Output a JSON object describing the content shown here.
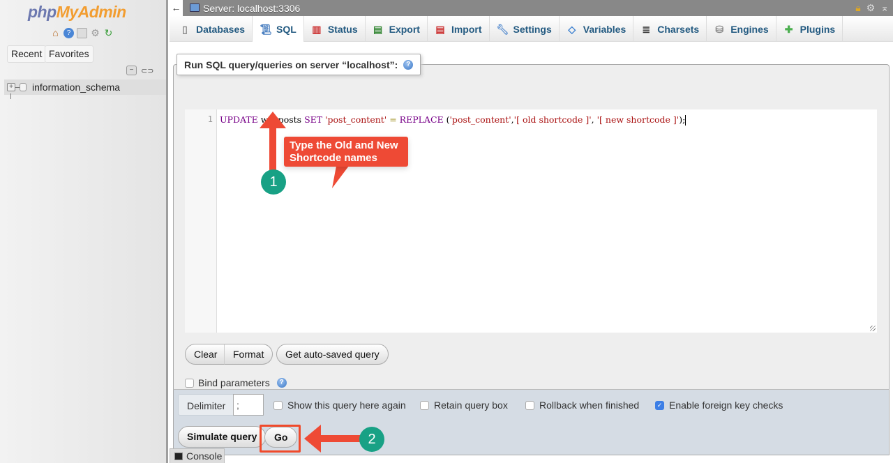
{
  "sidebar": {
    "logo_php": "php",
    "logo_my": "MyAdmin",
    "nav_icons": [
      "home-icon",
      "help-icon",
      "docs-icon",
      "settings-icon",
      "reload-icon"
    ],
    "recent_label": "Recent",
    "favorites_label": "Favorites",
    "tree": [
      {
        "name": "information_schema"
      }
    ]
  },
  "topbar": {
    "back_glyph": "←",
    "server_label": "Server: localhost:3306"
  },
  "tabs": [
    {
      "label": "Databases",
      "icon": "database-icon",
      "active": false
    },
    {
      "label": "SQL",
      "icon": "sql-icon",
      "active": true
    },
    {
      "label": "Status",
      "icon": "status-icon",
      "active": false
    },
    {
      "label": "Export",
      "icon": "export-icon",
      "active": false
    },
    {
      "label": "Import",
      "icon": "import-icon",
      "active": false
    },
    {
      "label": "Settings",
      "icon": "wrench-icon",
      "active": false
    },
    {
      "label": "Variables",
      "icon": "variables-icon",
      "active": false
    },
    {
      "label": "Charsets",
      "icon": "charsets-icon",
      "active": false
    },
    {
      "label": "Engines",
      "icon": "engines-icon",
      "active": false
    },
    {
      "label": "Plugins",
      "icon": "puzzle-icon",
      "active": false
    }
  ],
  "sql_panel": {
    "legend": "Run SQL query/queries on server “localhost”:",
    "line_number": "1",
    "query": {
      "t1": "UPDATE",
      "t2": " wp_posts ",
      "t3": "SET",
      "t4": " ",
      "t5": "'post_content'",
      "t6": " = ",
      "t7": "REPLACE",
      "t8": " (",
      "t9": "'post_content'",
      "t10": ",",
      "t11": "'[ old shortcode ]'",
      "t12": ", ",
      "t13": "'[ new shortcode ]'",
      "t14": ");"
    },
    "clear_label": "Clear",
    "format_label": "Format",
    "autosaved_label": "Get auto-saved query",
    "bind_parameters_label": "Bind parameters",
    "bind_parameters_checked": false
  },
  "footer": {
    "delimiter_label": "Delimiter",
    "delimiter_value": ";",
    "options": [
      {
        "label": "Show this query here again",
        "checked": false
      },
      {
        "label": "Retain query box",
        "checked": false
      },
      {
        "label": "Rollback when finished",
        "checked": false
      },
      {
        "label": "Enable foreign key checks",
        "checked": true
      }
    ],
    "simulate_label": "Simulate query",
    "go_label": "Go"
  },
  "console_label": "Console",
  "annotations": {
    "step1": "1",
    "step2": "2",
    "tip_text": "Type the Old and New Shortcode names",
    "accent_color": "#ee4a35",
    "badge_color": "#18a185"
  }
}
